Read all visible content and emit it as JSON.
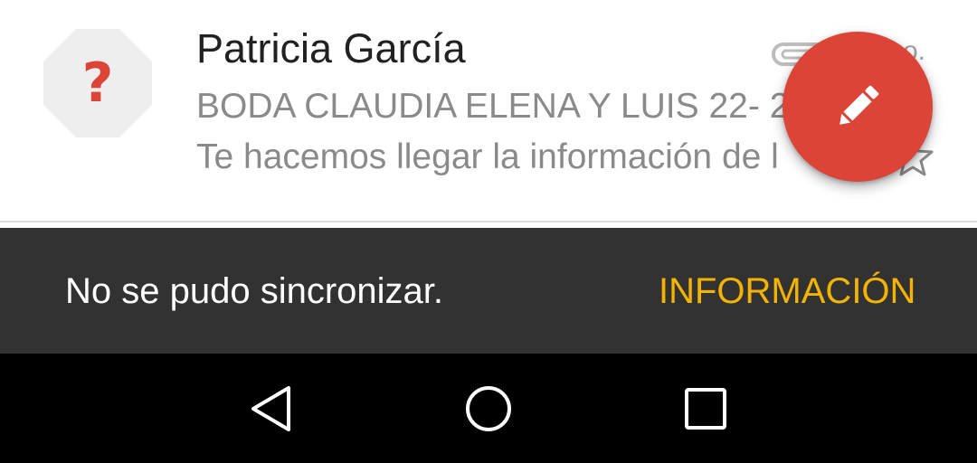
{
  "email": {
    "avatar_glyph": "?",
    "sender": "Patricia García",
    "subject": "BODA CLAUDIA ELENA Y LUIS 22- 2",
    "snippet": "Te hacemos llegar la información de l",
    "date_fragment": "o.",
    "icons": {
      "attachment": "attachment-icon",
      "star": "star-outline-icon"
    }
  },
  "fab": {
    "icon": "pencil-icon",
    "color": "#db4437"
  },
  "snackbar": {
    "message": "No se pudo sincronizar.",
    "action_label": "INFORMACIÓN",
    "action_color": "#f2b400",
    "background": "#323232"
  },
  "navbar": {
    "buttons": [
      "back-icon",
      "home-icon",
      "recents-icon"
    ]
  }
}
